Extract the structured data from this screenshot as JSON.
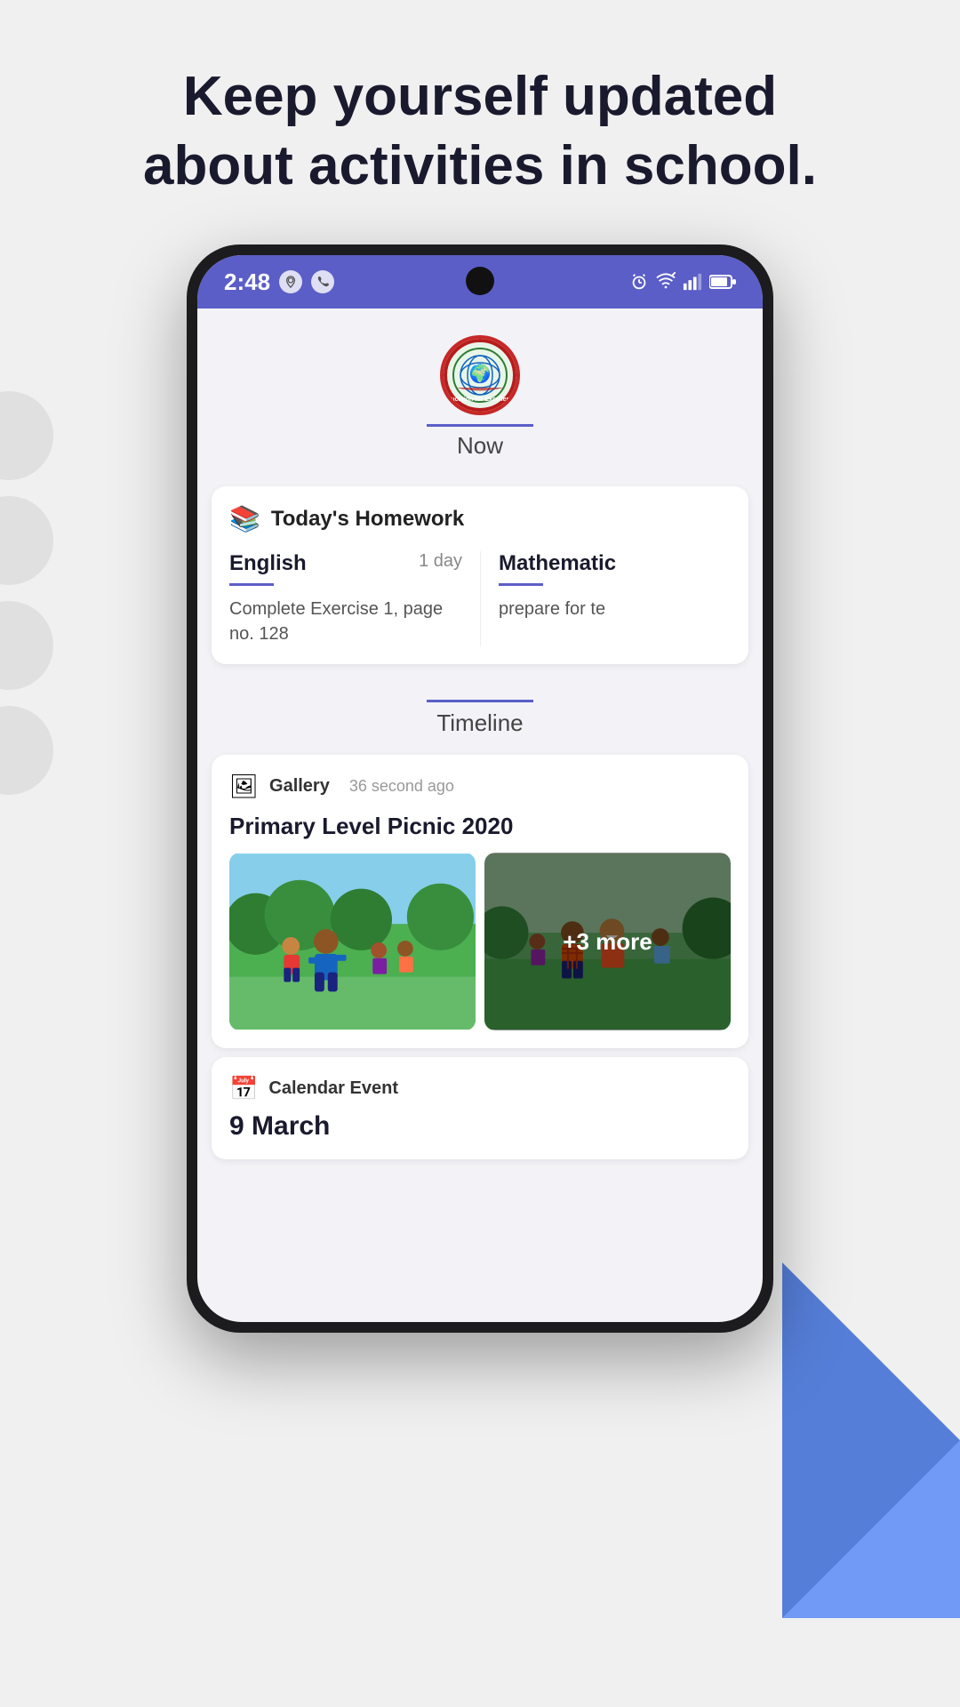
{
  "headline": {
    "line1": "Keep yourself updated",
    "line2": "about activities in school."
  },
  "statusBar": {
    "time": "2:48",
    "icons": [
      "map-icon",
      "whatsapp-icon"
    ],
    "rightIcons": [
      "alarm-icon",
      "wifi-icon",
      "signal-icon",
      "battery-icon"
    ]
  },
  "nowSection": {
    "label": "Now",
    "underline": true
  },
  "homeworkCard": {
    "icon": "📚",
    "title": "Today's Homework",
    "columns": [
      {
        "subject": "English",
        "duration": "1 day",
        "text": "Complete Exercise 1, page no. 128"
      },
      {
        "subject": "Mathematic",
        "duration": "",
        "text": "prepare for te"
      }
    ]
  },
  "timelineSection": {
    "label": "Timeline"
  },
  "galleryCard": {
    "icon": "🖼",
    "type": "Gallery",
    "timeAgo": "36 second ago",
    "title": "Primary Level Picnic 2020",
    "moreCount": "+3 more"
  },
  "calendarCard": {
    "icon": "📅",
    "type": "Calendar Event",
    "date": "9 March"
  },
  "colors": {
    "primary": "#5b5ec7",
    "accent": "#3b6bd4"
  }
}
